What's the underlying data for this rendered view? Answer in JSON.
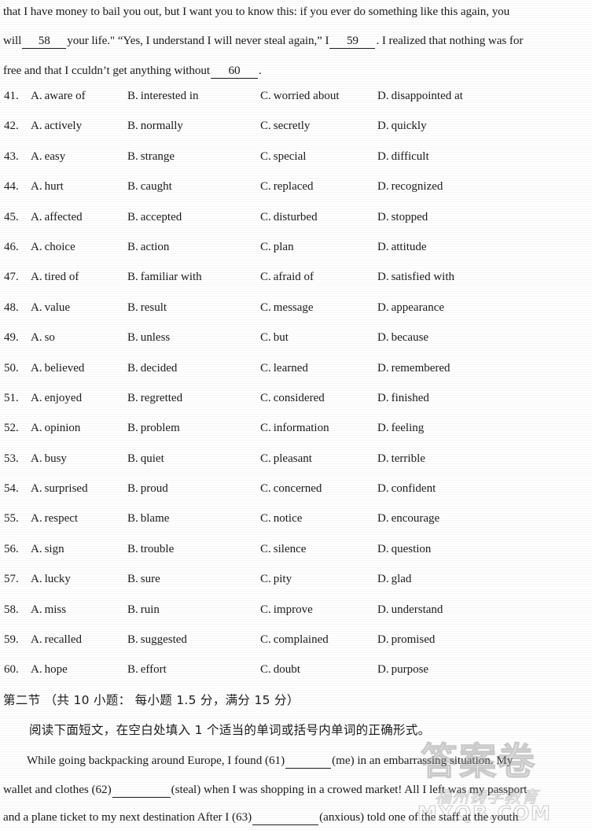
{
  "passage_top": {
    "line1": "that I have money to bail you out, but I want you to know this: if you ever do something like this again, you",
    "line2_pre": "will",
    "line2_blank1": "58",
    "line2_mid": "your life.\" “Yes, I understand  I will never steal again,” I",
    "line2_blank2": "59",
    "line2_post": ". I realized that nothing was for",
    "line3_pre": "free and that I cculdn’t get anything without",
    "line3_blank": "60",
    "line3_post": "."
  },
  "questions": [
    {
      "num": "41.",
      "a": "aware of",
      "b": "interested in",
      "c": "worried about",
      "d": "disappointed at"
    },
    {
      "num": "42.",
      "a": "actively",
      "b": "normally",
      "c": "secretly",
      "d": "quickly"
    },
    {
      "num": "43.",
      "a": "easy",
      "b": "strange",
      "c": "special",
      "d": "difficult"
    },
    {
      "num": "44.",
      "a": "hurt",
      "b": "caught",
      "c": "replaced",
      "d": "recognized"
    },
    {
      "num": "45.",
      "a": "affected",
      "b": "accepted",
      "c": "disturbed",
      "d": "stopped"
    },
    {
      "num": "46.",
      "a": "choice",
      "b": "action",
      "c": "plan",
      "d": "attitude"
    },
    {
      "num": "47.",
      "a": "tired of",
      "b": "familiar with",
      "c": "afraid of",
      "d": "satisfied with"
    },
    {
      "num": "48.",
      "a": "value",
      "b": "result",
      "c": "message",
      "d": "appearance"
    },
    {
      "num": "49.",
      "a": "so",
      "b": "unless",
      "c": "but",
      "d": "because"
    },
    {
      "num": "50.",
      "a": "believed",
      "b": "decided",
      "c": "learned",
      "d": "remembered"
    },
    {
      "num": "51.",
      "a": "enjoyed",
      "b": "regretted",
      "c": "considered",
      "d": "finished"
    },
    {
      "num": "52.",
      "a": "opinion",
      "b": "problem",
      "c": "information",
      "d": "feeling"
    },
    {
      "num": "53.",
      "a": "busy",
      "b": "quiet",
      "c": "pleasant",
      "d": "terrible"
    },
    {
      "num": "54.",
      "a": "surprised",
      "b": "proud",
      "c": "concerned",
      "d": "confident"
    },
    {
      "num": "55.",
      "a": "respect",
      "b": "blame",
      "c": "notice",
      "d": "encourage"
    },
    {
      "num": "56.",
      "a": "sign",
      "b": "trouble",
      "c": "silence",
      "d": "question"
    },
    {
      "num": "57.",
      "a": "lucky",
      "b": "sure",
      "c": "pity",
      "d": "glad"
    },
    {
      "num": "58.",
      "a": "miss",
      "b": "ruin",
      "c": "improve",
      "d": "understand"
    },
    {
      "num": "59.",
      "a": "recalled",
      "b": "suggested",
      "c": "complained",
      "d": "promised"
    },
    {
      "num": "60.",
      "a": "hope",
      "b": "effort",
      "c": "doubt",
      "d": "purpose"
    }
  ],
  "option_letters": {
    "a": "A.",
    "b": "B.",
    "c": "C.",
    "d": "D."
  },
  "section_two": {
    "heading": "第二节 （共 10 小题：  每小题 1.5 分，满分 15 分）",
    "instruction": "阅读下面短文，在空白处填入 1 个适当的单词或括号内单词的正确形式。"
  },
  "passage_bottom": {
    "line1_pre": "While going backpacking around Europe, I found (61)",
    "line1_post": "(me) in an embarrassing situation. My",
    "line2_pre": "wallet and clothes (62)",
    "line2_post": "(steal) when I was shopping in a crowed market! All I left was my passport",
    "line3_pre": "and a plane ticket to my next destination  After I (63)",
    "line3_post": "(anxious) told one of the staff at the youth"
  },
  "watermark": {
    "big": "答案卷",
    "mid": "福州铸学教育",
    "url": "MXQB.COM"
  },
  "colors": {
    "ink": "#1b1b1b",
    "paper": "#ffffff",
    "watermark": "#9a9a9a"
  }
}
